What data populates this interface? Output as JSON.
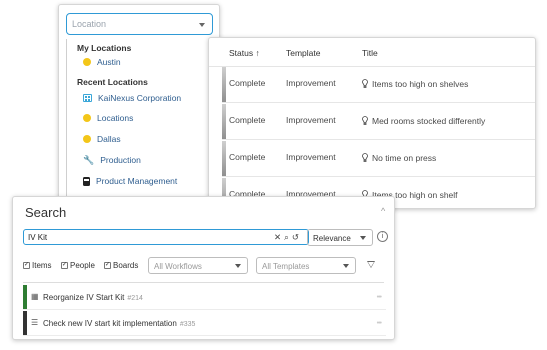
{
  "location_dropdown": {
    "placeholder": "Location",
    "my_locations_heading": "My Locations",
    "my_locations": [
      {
        "label": "Austin",
        "icon": "yellow-dot-icon"
      }
    ],
    "recent_heading": "Recent Locations",
    "recent_locations": [
      {
        "label": "KaiNexus Corporation",
        "icon": "building-icon"
      },
      {
        "label": "Locations",
        "icon": "yellow-dot-icon"
      },
      {
        "label": "Dallas",
        "icon": "yellow-dot-icon"
      },
      {
        "label": "Production",
        "icon": "wrench-icon"
      },
      {
        "label": "Product Management",
        "icon": "bus-icon"
      }
    ]
  },
  "status_table": {
    "columns": [
      "Status ↑",
      "Template",
      "Title"
    ],
    "rows": [
      {
        "status": "Complete",
        "template": "Improvement",
        "title": "Items too high on shelves"
      },
      {
        "status": "Complete",
        "template": "Improvement",
        "title": "Med rooms stocked differently"
      },
      {
        "status": "Complete",
        "template": "Improvement",
        "title": "No time on press"
      },
      {
        "status": "Complete",
        "template": "Improvement",
        "title": "Items too high on shelf"
      }
    ]
  },
  "search": {
    "title": "Search",
    "query": "IV Kit",
    "sort": "Relevance",
    "filters": {
      "items": "Items",
      "people": "People",
      "boards": "Boards"
    },
    "workflows_placeholder": "All Workflows",
    "templates_placeholder": "All Templates",
    "results": [
      {
        "title": "Reorganize IV Start Kit",
        "id": "#214",
        "icon": "table-icon",
        "color": "#2e7d32"
      },
      {
        "title": "Check new IV start kit implementation",
        "id": "#335",
        "icon": "list-icon",
        "color": "#333333"
      }
    ]
  },
  "colors": {
    "accent": "#2f9ad6",
    "location_dot": "#f3c619"
  }
}
